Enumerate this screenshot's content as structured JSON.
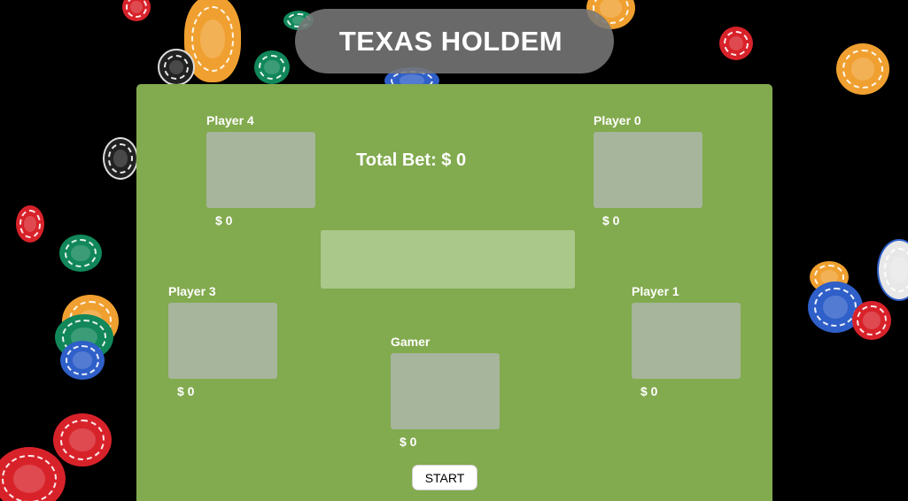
{
  "game": {
    "title": "TEXAS HOLDEM",
    "total_bet_label": "Total Bet: $ 0",
    "start_label": "START"
  },
  "seats": {
    "player4": {
      "name": "Player 4",
      "money": "$ 0"
    },
    "player0": {
      "name": "Player 0",
      "money": "$ 0"
    },
    "player3": {
      "name": "Player 3",
      "money": "$ 0"
    },
    "player1": {
      "name": "Player 1",
      "money": "$ 0"
    },
    "gamer": {
      "name": "Gamer",
      "money": "$ 0"
    }
  },
  "colors": {
    "background": "#000000",
    "felt": "#82aa4e",
    "card_slot": "#a6b59c",
    "board_slot": "#aac88a",
    "title_pill": "#787878",
    "text": "#ffffff"
  },
  "decorations": {
    "chip_colors": [
      "#f0a030",
      "#d8222a",
      "#11875a",
      "#2f5fc8",
      "#e8e8e8",
      "#222222"
    ]
  }
}
